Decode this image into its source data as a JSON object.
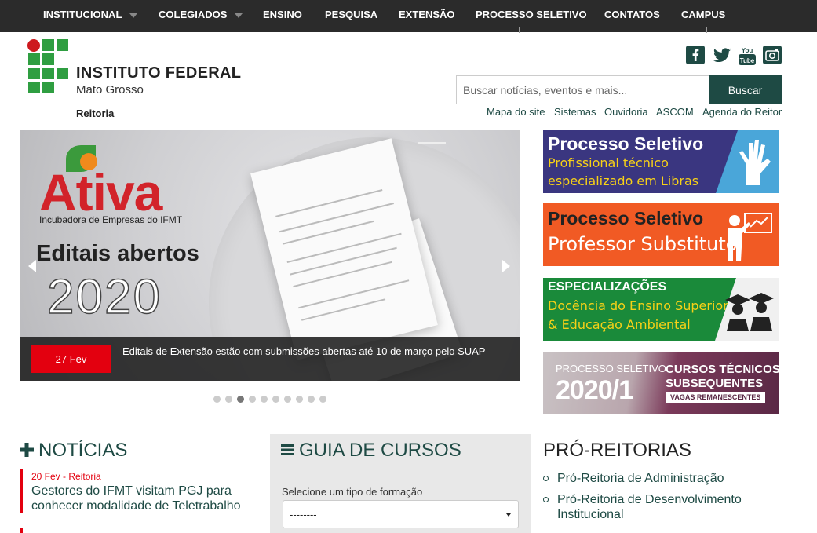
{
  "nav": {
    "items": [
      {
        "label": "INSTITUCIONAL",
        "caret": true
      },
      {
        "label": "COLEGIADOS",
        "caret": true
      },
      {
        "label": "ENSINO",
        "caret": false
      },
      {
        "label": "PESQUISA",
        "caret": false
      },
      {
        "label": "EXTENSÃO",
        "caret": false
      },
      {
        "label": "PROCESSO SELETIVO",
        "caret": false
      },
      {
        "label": "CONTATOS",
        "caret": false
      },
      {
        "label": "CAMPUS",
        "caret": false
      }
    ]
  },
  "brand": {
    "title": "INSTITUTO FEDERAL",
    "subtitle": "Mato Grosso",
    "unit": "Reitoria",
    "colors": {
      "green": "#2f9e41",
      "red": "#cd191e"
    }
  },
  "social": [
    "facebook-icon",
    "twitter-icon",
    "youtube-icon",
    "instagram-icon"
  ],
  "search": {
    "placeholder": "Buscar notícias, eventos e mais...",
    "button": "Buscar"
  },
  "utility_links": [
    "Mapa do site",
    "Sistemas",
    "Ouvidoria",
    "ASCOM",
    "Agenda do Reitor"
  ],
  "slider": {
    "logo_text": "Ativa",
    "logo_sub": "Incubadora de Empresas do IFMT",
    "headline": "Editais abertos",
    "year": "2020",
    "caption_date": "27 Fev",
    "caption_text": "Editais de Extensão estão com submissões abertas até 10 de março pelo SUAP",
    "dots_count": 10,
    "active_dot": 3
  },
  "banners": [
    {
      "line1": "Processo Seletivo",
      "line2": "Profissional técnico",
      "line3": "especializado em Libras",
      "bg": "#3d3780",
      "accent": "#4aa3d8"
    },
    {
      "line1": "Processo Seletivo",
      "line2": "Professor Substituto",
      "line3": "",
      "bg": "#f15a24",
      "accent": "#f15a24"
    },
    {
      "line1": "ESPECIALIZAÇÕES",
      "line2": "Docência do  Ensino Superior",
      "line3": "& Educação Ambiental",
      "bg": "#1a8a3a",
      "accent": "#1a8a3a"
    },
    {
      "line1": "PROCESSO SELETIVO",
      "line2": "2020/1",
      "line3": "CURSOS TÉCNICOS",
      "line4": "SUBSEQUENTES",
      "line5": "VAGAS REMANESCENTES",
      "bg": "#7a3a5a",
      "accent": "#5e2a46"
    }
  ],
  "news": {
    "title": "NOTÍCIAS",
    "items": [
      {
        "meta": "20 Fev - Reitoria",
        "title": "Gestores do IFMT visitam PGJ para conhecer modalidade de Teletrabalho"
      }
    ]
  },
  "guia": {
    "title": "GUIA DE CURSOS",
    "select_label": "Selecione um tipo de formação",
    "select_value": "--------"
  },
  "pro": {
    "title": "PRÓ-REITORIAS",
    "items": [
      "Pró-Reitoria de Administração",
      "Pró-Reitoria de Desenvolvimento Institucional"
    ]
  }
}
